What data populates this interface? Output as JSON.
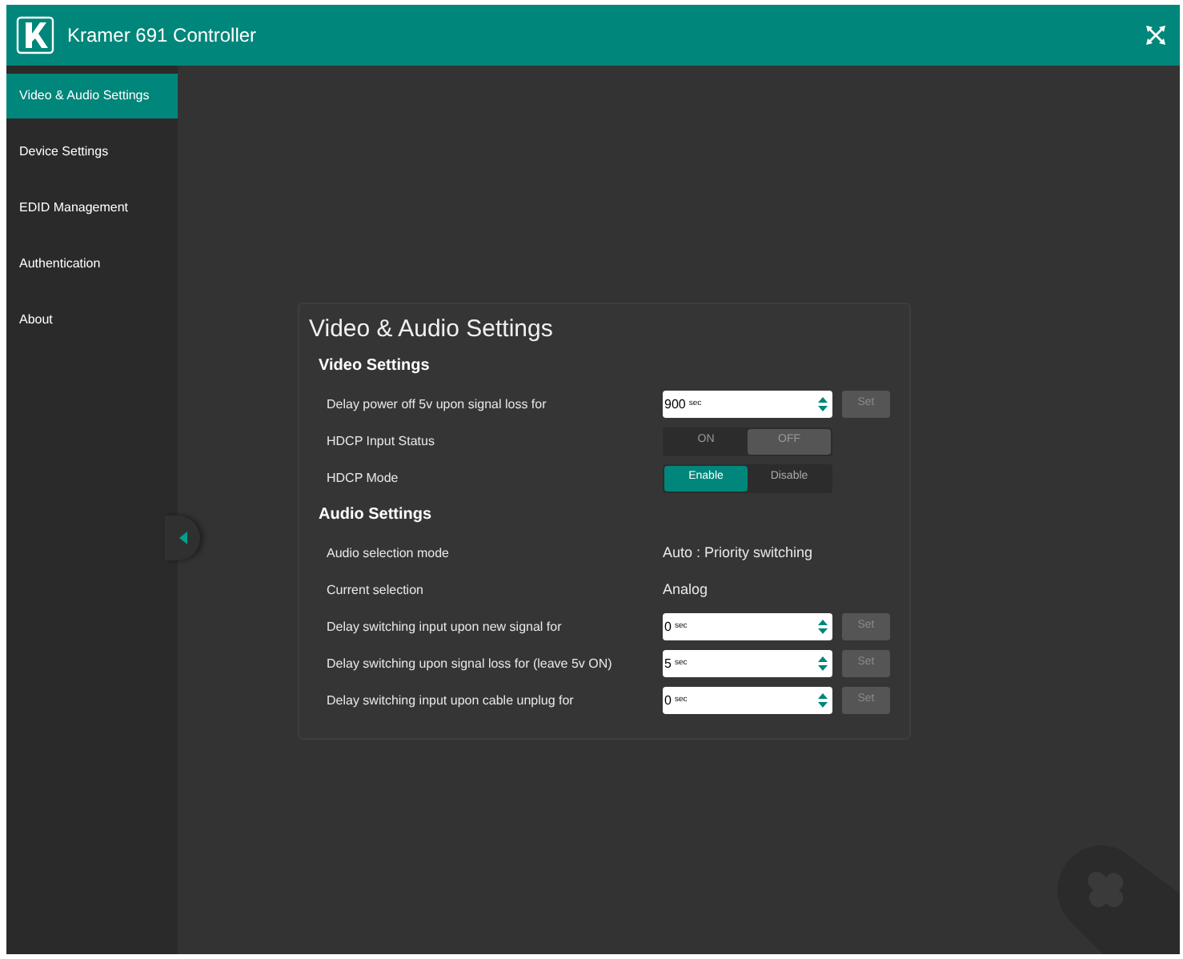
{
  "header": {
    "title": "Kramer 691 Controller"
  },
  "sidebar": {
    "items": [
      {
        "label": "Video & Audio Settings",
        "selected": true
      },
      {
        "label": "Device Settings",
        "selected": false
      },
      {
        "label": "EDID Management",
        "selected": false
      },
      {
        "label": "Authentication",
        "selected": false
      },
      {
        "label": "About",
        "selected": false
      }
    ]
  },
  "panel": {
    "title": "Video & Audio Settings",
    "sections": [
      {
        "title": "Video Settings",
        "rows": [
          {
            "kind": "spinner",
            "label": "Delay power off 5v upon signal loss for",
            "value": "900",
            "unit": "sec",
            "button": {
              "label": "Set",
              "disabled": true
            }
          },
          {
            "kind": "status",
            "label": "HDCP Input Status",
            "options": [
              {
                "label": "ON",
                "selected": false
              },
              {
                "label": "OFF",
                "selected": true
              }
            ]
          },
          {
            "kind": "toggle",
            "label": "HDCP Mode",
            "options": [
              {
                "label": "Enable",
                "selected": true
              },
              {
                "label": "Disable",
                "selected": false
              }
            ]
          }
        ]
      },
      {
        "title": "Audio Settings",
        "rows": [
          {
            "kind": "text",
            "label": "Audio selection mode",
            "value": "Auto : Priority switching"
          },
          {
            "kind": "text",
            "label": "Current selection",
            "value": "Analog"
          },
          {
            "kind": "spinner",
            "label": "Delay switching input upon new signal for",
            "value": "0",
            "unit": "sec",
            "button": {
              "label": "Set",
              "disabled": true
            }
          },
          {
            "kind": "spinner",
            "label": "Delay switching upon signal loss for (leave 5v ON)",
            "value": "5",
            "unit": "sec",
            "button": {
              "label": "Set",
              "disabled": true
            }
          },
          {
            "kind": "spinner",
            "label": "Delay switching input upon cable unplug for",
            "value": "0",
            "unit": "sec",
            "button": {
              "label": "Set",
              "disabled": true
            }
          }
        ]
      }
    ]
  }
}
